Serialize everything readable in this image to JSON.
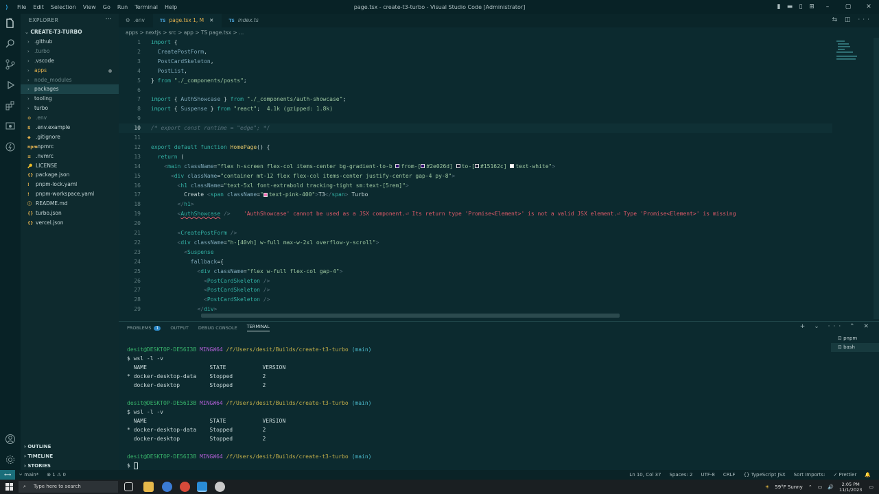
{
  "titlebar": {
    "menu": [
      "File",
      "Edit",
      "Selection",
      "View",
      "Go",
      "Run",
      "Terminal",
      "Help"
    ],
    "title": "page.tsx - create-t3-turbo - Visual Studio Code [Administrator]"
  },
  "sidebar": {
    "title": "EXPLORER",
    "root": "CREATE-T3-TURBO",
    "items": [
      {
        "label": ".github",
        "type": "folder",
        "color": "#c5d6d7"
      },
      {
        "label": ".turbo",
        "type": "folder",
        "color": "#6b8789"
      },
      {
        "label": ".vscode",
        "type": "folder",
        "color": "#c5d6d7"
      },
      {
        "label": "apps",
        "type": "folder",
        "color": "#e2b04e"
      },
      {
        "label": "node_modules",
        "type": "folder",
        "color": "#6b8789"
      },
      {
        "label": "packages",
        "type": "folder",
        "color": "#c5d6d7"
      },
      {
        "label": "tooling",
        "type": "folder",
        "color": "#c5d6d7"
      },
      {
        "label": "turbo",
        "type": "folder",
        "color": "#c5d6d7"
      },
      {
        "label": ".env",
        "type": "file",
        "color": "#6b8789",
        "icon": "⚙"
      },
      {
        "label": ".env.example",
        "type": "file",
        "color": "#c5d6d7",
        "icon": "$"
      },
      {
        "label": ".gitignore",
        "type": "file",
        "color": "#c5d6d7",
        "icon": "◆"
      },
      {
        "label": ".npmrc",
        "type": "file",
        "color": "#c5d6d7",
        "icon": "npm"
      },
      {
        "label": ".nvmrc",
        "type": "file",
        "color": "#c5d6d7",
        "icon": "≡"
      },
      {
        "label": "LICENSE",
        "type": "file",
        "color": "#c5d6d7",
        "icon": "🔑"
      },
      {
        "label": "package.json",
        "type": "file",
        "color": "#c5d6d7",
        "icon": "{}"
      },
      {
        "label": "pnpm-lock.yaml",
        "type": "file",
        "color": "#c5d6d7",
        "icon": "!"
      },
      {
        "label": "pnpm-workspace.yaml",
        "type": "file",
        "color": "#c5d6d7",
        "icon": "!"
      },
      {
        "label": "README.md",
        "type": "file",
        "color": "#c5d6d7",
        "icon": "ⓘ"
      },
      {
        "label": "turbo.json",
        "type": "file",
        "color": "#c5d6d7",
        "icon": "{}"
      },
      {
        "label": "vercel.json",
        "type": "file",
        "color": "#c5d6d7",
        "icon": "{}"
      }
    ],
    "sections": [
      "OUTLINE",
      "TIMELINE",
      "STORIES"
    ]
  },
  "tabs": [
    {
      "label": ".env",
      "icon": "⚙",
      "active": false
    },
    {
      "label": "page.tsx 1, M",
      "icon": "TS",
      "active": true
    },
    {
      "label": "index.ts",
      "icon": "TS",
      "active": false
    }
  ],
  "breadcrumb": "apps > nextjs > src > app > TS page.tsx > ...",
  "code": [
    {
      "n": "1",
      "html": "<span class='k'>import</span> <span class='w'>{</span>"
    },
    {
      "n": "2",
      "html": "  <span class='t'>CreatePostForm</span><span class='w'>,</span>"
    },
    {
      "n": "3",
      "html": "  <span class='t'>PostCardSkeleton</span><span class='w'>,</span>"
    },
    {
      "n": "4",
      "html": "  <span class='t'>PostList</span><span class='w'>,</span>"
    },
    {
      "n": "5",
      "html": "<span class='w'>}</span> <span class='k'>from</span> <span class='s'>\"./_components/posts\"</span><span class='w'>;</span>"
    },
    {
      "n": "6",
      "html": ""
    },
    {
      "n": "7",
      "html": "<span class='k'>import</span> <span class='w'>{</span> <span class='t'>AuthShowcase</span> <span class='w'>}</span> <span class='k'>from</span> <span class='s'>\"./_components/auth-showcase\"</span><span class='w'>;</span>"
    },
    {
      "n": "8",
      "html": "<span class='k'>import</span> <span class='w'>{</span> <span class='t'>Suspense</span> <span class='w'>}</span> <span class='k'>from</span> <span class='s'>\"react\"</span><span class='w'>;</span>  <span class='s'>4.1k (gzipped: 1.8k)</span>"
    },
    {
      "n": "9",
      "html": ""
    },
    {
      "n": "10",
      "html": "<span class='c'>/* export const runtime = \"edge\"; */</span>",
      "cur": true
    },
    {
      "n": "11",
      "html": ""
    },
    {
      "n": "12",
      "html": "<span class='k'>export default function</span> <span class='b'>HomePage</span><span class='w'>() {</span>"
    },
    {
      "n": "13",
      "html": "  <span class='k'>return</span> <span class='w'>(</span>"
    },
    {
      "n": "14",
      "html": "    <span class='g'>&lt;</span><span class='k'>main</span> <span class='t'>className</span><span class='w'>=</span><span class='s'>\"flex h-screen flex-col items-center bg-gradient-to-b <span class='swatch' style='background:#2e026d'></span>from-[<span class='swatch' style='background:#2e026d'></span>#2e026d] <span class='swatch' style='background:#15162c'></span>to-[<span class='swatch' style='background:#15162c'></span>#15162c] <span class='swatch' style='background:#fff'></span>text-white\"</span><span class='g'>&gt;</span>"
    },
    {
      "n": "15",
      "html": "      <span class='g'>&lt;</span><span class='k'>div</span> <span class='t'>className</span><span class='w'>=</span><span class='s'>\"container mt-12 flex flex-col items-center justify-center gap-4 py-8\"</span><span class='g'>&gt;</span>"
    },
    {
      "n": "16",
      "html": "        <span class='g'>&lt;</span><span class='k'>h1</span> <span class='t'>className</span><span class='w'>=</span><span class='s'>\"text-5xl font-extrabold tracking-tight sm:text-[5rem]\"</span><span class='g'>&gt;</span>"
    },
    {
      "n": "17",
      "html": "          <span class='w'>Create</span> <span class='g'>&lt;</span><span class='k'>span</span> <span class='t'>className</span><span class='w'>=</span><span class='s'>\"<span class='swatch' style='background:#f472b6'></span>text-pink-400\"</span><span class='g'>&gt;</span><span class='w'>T3</span><span class='g'>&lt;/</span><span class='k'>span</span><span class='g'>&gt;</span> <span class='w'>Turbo</span>"
    },
    {
      "n": "18",
      "html": "        <span class='g'>&lt;/</span><span class='k'>h1</span><span class='g'>&gt;</span>"
    },
    {
      "n": "19",
      "html": "        <span class='g'>&lt;</span><span class='k' style='text-decoration:underline wavy #e05a69'>AuthShowcase</span> <span class='g'>/&gt;</span>    <span class='e'>'AuthShowcase' cannot be used as a JSX component.⏎ Its return type 'Promise&lt;Element&gt;' is not a valid JSX element.⏎ Type 'Promise&lt;Element&gt;' is missing</span>"
    },
    {
      "n": "20",
      "html": ""
    },
    {
      "n": "21",
      "html": "        <span class='g'>&lt;</span><span class='k'>CreatePostForm</span> <span class='g'>/&gt;</span>"
    },
    {
      "n": "22",
      "html": "        <span class='g'>&lt;</span><span class='k'>div</span> <span class='t'>className</span><span class='w'>=</span><span class='s'>\"h-[40vh] w-full max-w-2xl overflow-y-scroll\"</span><span class='g'>&gt;</span>"
    },
    {
      "n": "23",
      "html": "          <span class='g'>&lt;</span><span class='k'>Suspense</span>"
    },
    {
      "n": "24",
      "html": "            <span class='t'>fallback</span><span class='w'>={</span>"
    },
    {
      "n": "25",
      "html": "              <span class='g'>&lt;</span><span class='k'>div</span> <span class='t'>className</span><span class='w'>=</span><span class='s'>\"flex w-full flex-col gap-4\"</span><span class='g'>&gt;</span>"
    },
    {
      "n": "26",
      "html": "                <span class='g'>&lt;</span><span class='k'>PostCardSkeleton</span> <span class='g'>/&gt;</span>"
    },
    {
      "n": "27",
      "html": "                <span class='g'>&lt;</span><span class='k'>PostCardSkeleton</span> <span class='g'>/&gt;</span>"
    },
    {
      "n": "28",
      "html": "                <span class='g'>&lt;</span><span class='k'>PostCardSkeleton</span> <span class='g'>/&gt;</span>"
    },
    {
      "n": "29",
      "html": "              <span class='g'>&lt;/</span><span class='k'>div</span><span class='g'>&gt;</span>"
    }
  ],
  "panel": {
    "tabs": [
      {
        "label": "PROBLEMS",
        "badge": "1"
      },
      {
        "label": "OUTPUT"
      },
      {
        "label": "DEBUG CONSOLE"
      },
      {
        "label": "TERMINAL",
        "active": true
      }
    ],
    "terminal_list": [
      "pnpm",
      "bash"
    ],
    "terminal_lines": [
      {
        "type": "prompt",
        "user": "desit@DESKTOP-DE56I3B",
        "sys": "MINGW64",
        "path": "/f/Users/desit/Builds/create-t3-turbo",
        "branch": "(main)"
      },
      {
        "type": "cmd",
        "text": "$ wsl -l -v"
      },
      {
        "type": "text",
        "text": "  NAME                   STATE           VERSION"
      },
      {
        "type": "text",
        "text": "* docker-desktop-data    Stopped         2"
      },
      {
        "type": "text",
        "text": "  docker-desktop         Stopped         2"
      },
      {
        "type": "blank",
        "text": ""
      },
      {
        "type": "prompt",
        "user": "desit@DESKTOP-DE56I3B",
        "sys": "MINGW64",
        "path": "/f/Users/desit/Builds/create-t3-turbo",
        "branch": "(main)"
      },
      {
        "type": "cmd",
        "text": "$ wsl -l -v"
      },
      {
        "type": "text",
        "text": "  NAME                   STATE           VERSION"
      },
      {
        "type": "text",
        "text": "* docker-desktop-data    Stopped         2"
      },
      {
        "type": "text",
        "text": "  docker-desktop         Stopped         2"
      },
      {
        "type": "blank",
        "text": ""
      },
      {
        "type": "prompt",
        "user": "desit@DESKTOP-DE56I3B",
        "sys": "MINGW64",
        "path": "/f/Users/desit/Builds/create-t3-turbo",
        "branch": "(main)"
      },
      {
        "type": "cursor",
        "text": "$ "
      }
    ]
  },
  "statusbar": {
    "branch": "main*",
    "problems": "⊗ 1 ⚠ 0",
    "right": [
      "Ln 10, Col 37",
      "Spaces: 2",
      "UTF-8",
      "CRLF",
      "{} TypeScript JSX",
      "Sort Imports:",
      "✓ Prettier"
    ]
  },
  "taskbar": {
    "search_placeholder": "Type here to search",
    "weather": "59°F  Sunny",
    "time": "2:05 PM",
    "date": "11/1/2023"
  },
  "colors": {
    "accent": "#2aa7e7",
    "modified": "#e2b04e",
    "error": "#e05a69"
  }
}
